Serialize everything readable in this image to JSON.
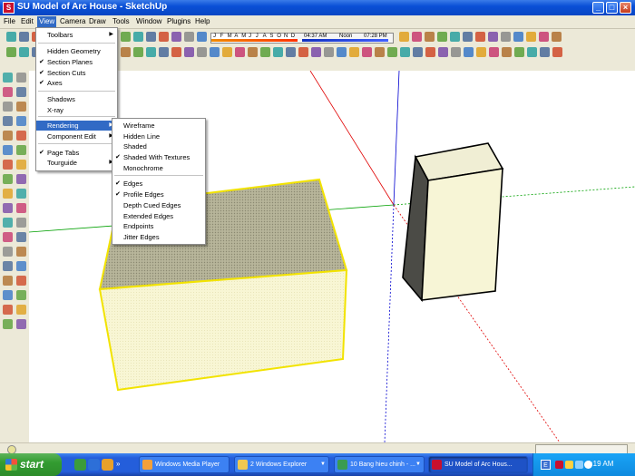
{
  "window": {
    "title": "SU Model of Arc House - SketchUp"
  },
  "menubar": [
    "File",
    "Edit",
    "View",
    "Camera",
    "Draw",
    "Tools",
    "Window",
    "Plugins",
    "Help"
  ],
  "shadow_settings": {
    "months": [
      "J",
      "F",
      "M",
      "A",
      "M",
      "J",
      "J",
      "A",
      "S",
      "O",
      "N",
      "D"
    ],
    "sunrise": "04:37 AM",
    "noon": "Noon",
    "sunset": "07:28 PM"
  },
  "view_menu": [
    {
      "label": "Toolbars",
      "checked": false,
      "submenu": true
    },
    {
      "label": "Hidden Geometry",
      "checked": false
    },
    {
      "label": "Section Planes",
      "checked": true
    },
    {
      "label": "Section Cuts",
      "checked": true
    },
    {
      "label": "Axes",
      "checked": true
    },
    {
      "label": "Shadows",
      "checked": false
    },
    {
      "label": "X-ray",
      "checked": false
    },
    {
      "label": "Rendering",
      "checked": false,
      "submenu": true,
      "highlighted": true
    },
    {
      "label": "Component Edit",
      "checked": false,
      "submenu": true
    },
    {
      "label": "Page Tabs",
      "checked": true
    },
    {
      "label": "Tourguide",
      "checked": false,
      "submenu": true
    }
  ],
  "rendering_menu": [
    {
      "label": "Wireframe",
      "checked": false
    },
    {
      "label": "Hidden Line",
      "checked": false
    },
    {
      "label": "Shaded",
      "checked": false
    },
    {
      "label": "Shaded With Textures",
      "checked": true
    },
    {
      "label": "Monochrome",
      "checked": false
    },
    {
      "label": "Edges",
      "checked": true
    },
    {
      "label": "Profile Edges",
      "checked": true
    },
    {
      "label": "Depth Cued Edges",
      "checked": false
    },
    {
      "label": "Extended Edges",
      "checked": false
    },
    {
      "label": "Endpoints",
      "checked": false
    },
    {
      "label": "Jitter Edges",
      "checked": false
    }
  ],
  "taskbar": {
    "start_label": "start",
    "tasks": [
      {
        "label": "Windows Media Player",
        "active": false,
        "arrow": false
      },
      {
        "label": "2 Windows Explorer",
        "active": false,
        "arrow": true
      },
      {
        "label": "10 Bang hieu chinh - ...",
        "active": false,
        "arrow": true
      },
      {
        "label": "SU Model of Arc Hous...",
        "active": true,
        "arrow": false
      }
    ],
    "tray_lang": "E",
    "clock": "2:19 AM"
  },
  "colors": {
    "selection": "#f2e300",
    "box_face": "#f6f3cf",
    "box_top": "#a5a284",
    "axis_red": "#e00000",
    "axis_green": "#00a000",
    "axis_blue": "#0000d0",
    "ground": "#a8a8a8"
  },
  "icons": [
    "sketchup-app-icon",
    "minimize-icon",
    "maximize-icon",
    "close-icon",
    "windows-logo-icon",
    "speaker-icon",
    "network-icon"
  ]
}
